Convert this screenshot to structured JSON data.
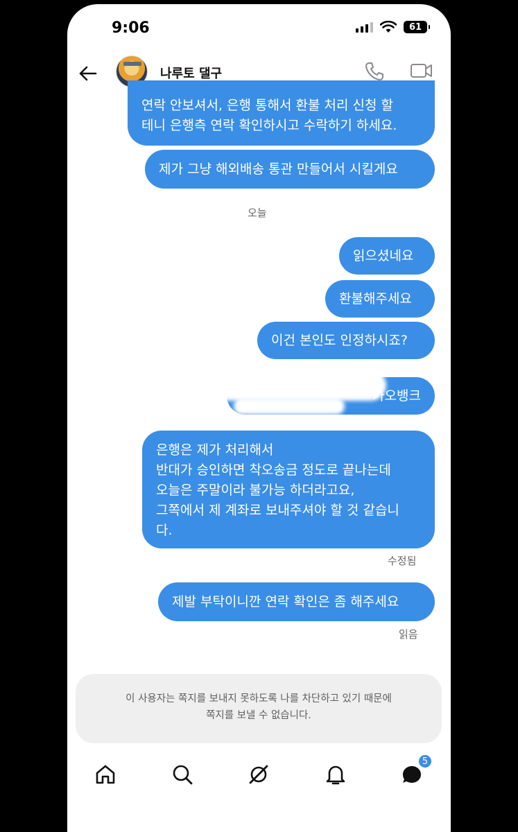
{
  "status_bar": {
    "time": "9:06",
    "battery": "61"
  },
  "header": {
    "contact_name": "나루토 댈구"
  },
  "messages": [
    {
      "text": "연락 안보셔서, 은행 통해서 환불 처리 신청 할\n테니 은행측 연락 확인하시고 수락하기 하세요."
    },
    {
      "text": "제가 그냥 해외배송 통관 만들어서 시킬게요"
    },
    {
      "text": "읽으셨네요"
    },
    {
      "text": "환불해주세요"
    },
    {
      "text": "이건 본인도 인정하시죠?"
    },
    {
      "text": "카오뱅크"
    },
    {
      "text": "은행은 제가 처리해서\n반대가 승인하면 착오송금 정도로 끝나는데\n오늘은 주말이라 불가능 하더라고요,\n그쪽에서 제 계좌로 보내주셔야 할 것 같습니\n다."
    },
    {
      "text": "제발 부탁이니깐 연락 확인은 좀 해주세요"
    }
  ],
  "date_separator": "오늘",
  "edited_label": "수정됨",
  "read_label": "읽음",
  "blocked_notice": {
    "line1": "이 사용자는 쪽지를 보내지 못하도록 나를 차단하고 있기 때문에",
    "line2": "쪽지를 보낼 수 없습니다."
  },
  "nav": {
    "messages_badge": "5"
  },
  "colors": {
    "bubble": "#3a8ee6",
    "notice_bg": "#efefef"
  }
}
